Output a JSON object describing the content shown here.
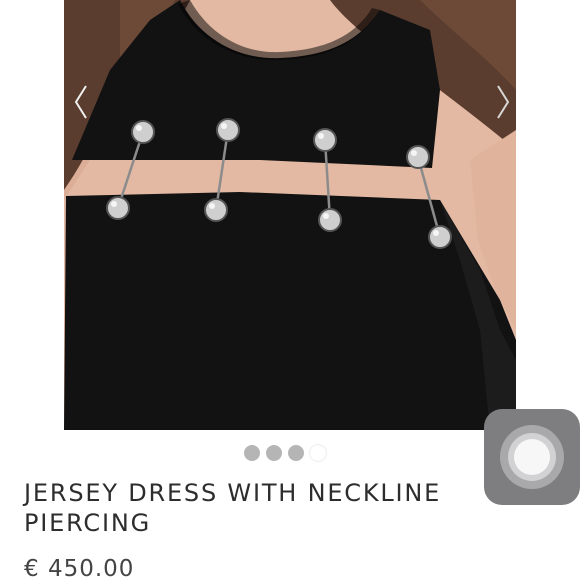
{
  "product": {
    "title": "JERSEY DRESS WITH NECKLINE PIERCING",
    "price": "€ 450.00"
  },
  "gallery": {
    "image_count": 4,
    "active_index": 4
  },
  "icons": {
    "prev": "chevron-left-icon",
    "next": "chevron-right-icon",
    "assistive": "assistive-touch-icon"
  },
  "colors": {
    "dress": "#111111",
    "hair": "#5a3d2e",
    "skin": "#e3b9a3",
    "dot_inactive": "#b5b5b5",
    "dot_active": "#ffffff",
    "title_text": "#2d2d2d"
  }
}
